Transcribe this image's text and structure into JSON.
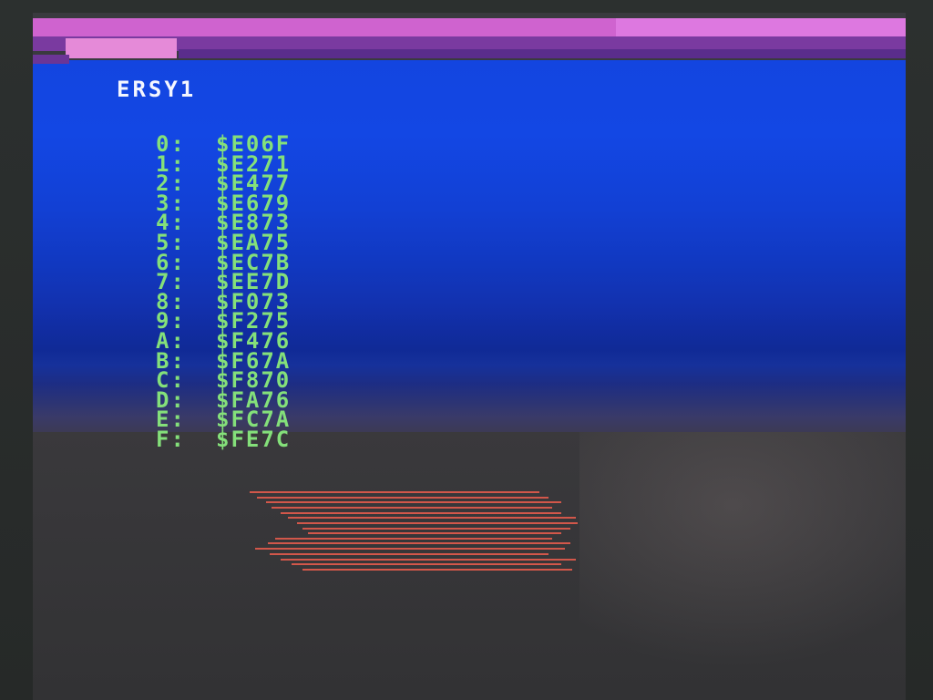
{
  "title": "ERSY1",
  "entries": [
    {
      "key": "0:",
      "value": "$E06F"
    },
    {
      "key": "1:",
      "value": "$E271"
    },
    {
      "key": "2:",
      "value": "$E477"
    },
    {
      "key": "3:",
      "value": "$E679"
    },
    {
      "key": "4:",
      "value": "$E873"
    },
    {
      "key": "5:",
      "value": "$EA75"
    },
    {
      "key": "6:",
      "value": "$EC7B"
    },
    {
      "key": "7:",
      "value": "$EE7D"
    },
    {
      "key": "8:",
      "value": "$F073"
    },
    {
      "key": "9:",
      "value": "$F275"
    },
    {
      "key": "A:",
      "value": "$F476"
    },
    {
      "key": "B:",
      "value": "$F67A"
    },
    {
      "key": "C:",
      "value": "$F870"
    },
    {
      "key": "D:",
      "value": "$FA76"
    },
    {
      "key": "E:",
      "value": "$FC7A"
    },
    {
      "key": "F:",
      "value": "$FE7C"
    }
  ],
  "colors": {
    "text_green": "#84e07a",
    "title_white": "#f4f6ff",
    "raster_blue": "#1345e0",
    "raster_magenta": "#cf63cf",
    "scanline_red": "#d2574a"
  }
}
